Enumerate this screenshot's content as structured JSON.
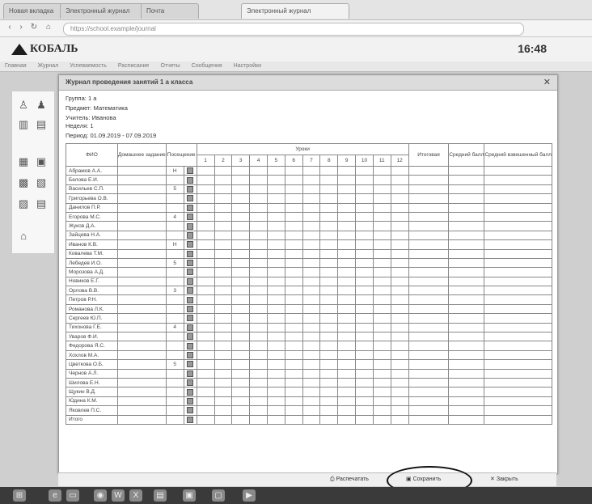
{
  "browser": {
    "tabs": [
      "Новая вкладка",
      "Электронный журнал",
      "Почта",
      "Электронный журнал"
    ],
    "url": "https://school.example/journal"
  },
  "app": {
    "logo": "КОБАЛЬ",
    "time": "16:48",
    "menu": [
      "Главная",
      "Журнал",
      "Успеваемость",
      "Расписание",
      "Отчеты",
      "Сообщения",
      "Настройки"
    ]
  },
  "panel": {
    "title": "Журнал проведения занятий 1 а класса",
    "line1": "Группа: 1 а",
    "line2": "Предмет: Математика",
    "line3": "Учитель: Ивановa",
    "line4": "Неделя: 1",
    "line5": "Период: 01.09.2019 - 07.09.2019"
  },
  "grid": {
    "headers": {
      "name": "ФИО",
      "hw": "Домашнее задание",
      "attend": "Посещение",
      "lessons": "Уроки",
      "total": "Итоговая",
      "avg": "Средний балл",
      "weighted": "Средний взвешенный балл"
    },
    "lesson_numbers": [
      "1",
      "2",
      "3",
      "4",
      "5",
      "6",
      "7",
      "8",
      "9",
      "10",
      "11",
      "12"
    ],
    "rows": [
      {
        "name": "Абрамов А.А.",
        "mark": "Н"
      },
      {
        "name": "Белова Е.И.",
        "mark": ""
      },
      {
        "name": "Васильев С.П.",
        "mark": "5"
      },
      {
        "name": "Григорьева О.В.",
        "mark": ""
      },
      {
        "name": "Данилов П.Р.",
        "mark": ""
      },
      {
        "name": "Егорова М.С.",
        "mark": "4"
      },
      {
        "name": "Жуков Д.А.",
        "mark": ""
      },
      {
        "name": "Зайцева Н.А.",
        "mark": ""
      },
      {
        "name": "Иванов К.В.",
        "mark": "Н"
      },
      {
        "name": "Ковалева Т.М.",
        "mark": ""
      },
      {
        "name": "Лебедев И.О.",
        "mark": "5"
      },
      {
        "name": "Морозова А.Д.",
        "mark": ""
      },
      {
        "name": "Новиков Е.Г.",
        "mark": ""
      },
      {
        "name": "Орлова В.В.",
        "mark": "3"
      },
      {
        "name": "Петров Р.Н.",
        "mark": ""
      },
      {
        "name": "Романова Л.К.",
        "mark": ""
      },
      {
        "name": "Сергеев Ю.П.",
        "mark": ""
      },
      {
        "name": "Тихонова Г.Е.",
        "mark": "4"
      },
      {
        "name": "Уваров Ф.И.",
        "mark": ""
      },
      {
        "name": "Федорова Я.С.",
        "mark": ""
      },
      {
        "name": "Хохлов М.А.",
        "mark": ""
      },
      {
        "name": "Цветкова О.Б.",
        "mark": "5"
      },
      {
        "name": "Чернов А.Л.",
        "mark": ""
      },
      {
        "name": "Шилова Е.Н.",
        "mark": ""
      },
      {
        "name": "Щукин В.Д.",
        "mark": ""
      },
      {
        "name": "Юдина К.М.",
        "mark": ""
      },
      {
        "name": "Яковлев П.С.",
        "mark": ""
      },
      {
        "name": "Итого",
        "mark": ""
      }
    ]
  },
  "footer": {
    "print": "Распечатать",
    "save": "Сохранить",
    "close": "Закрыть"
  }
}
